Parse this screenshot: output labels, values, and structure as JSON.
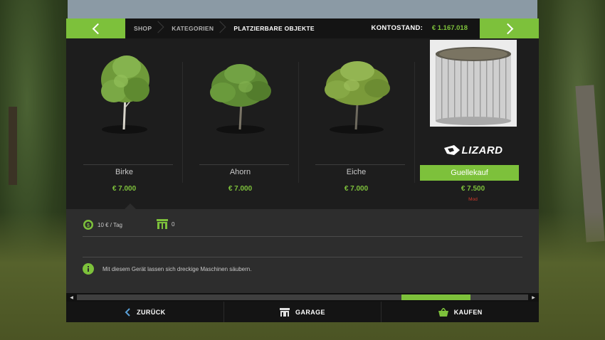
{
  "breadcrumb": [
    "SHOP",
    "KATEGORIEN",
    "PLATZIERBARE OBJEKTE"
  ],
  "account": {
    "label": "KONTOSTAND:",
    "value": "€ 1.167.018"
  },
  "items": [
    {
      "name": "Birke",
      "price": "€ 7.000",
      "icon": "birch-tree-icon"
    },
    {
      "name": "Ahorn",
      "price": "€ 7.000",
      "icon": "maple-tree-icon"
    },
    {
      "name": "Eiche",
      "price": "€ 7.000",
      "icon": "oak-tree-icon"
    },
    {
      "name": "Guellekauf",
      "price": "€ 7.500",
      "tag": "Mod",
      "brand": "LIZARD",
      "icon": "slurry-tank-icon",
      "selected": true
    }
  ],
  "details": {
    "cost_per_day": "10 € / Tag",
    "slots": "0",
    "info": "Mit diesem Gerät lassen sich dreckige Maschinen säubern."
  },
  "bottom_bar": {
    "back": "ZURÜCK",
    "garage": "GARAGE",
    "buy": "KAUFEN"
  },
  "scroll_position": 0.85,
  "colors": {
    "accent": "#7dc13b",
    "panel": "#1b1b1b",
    "mod_tag": "#d33a2a"
  }
}
